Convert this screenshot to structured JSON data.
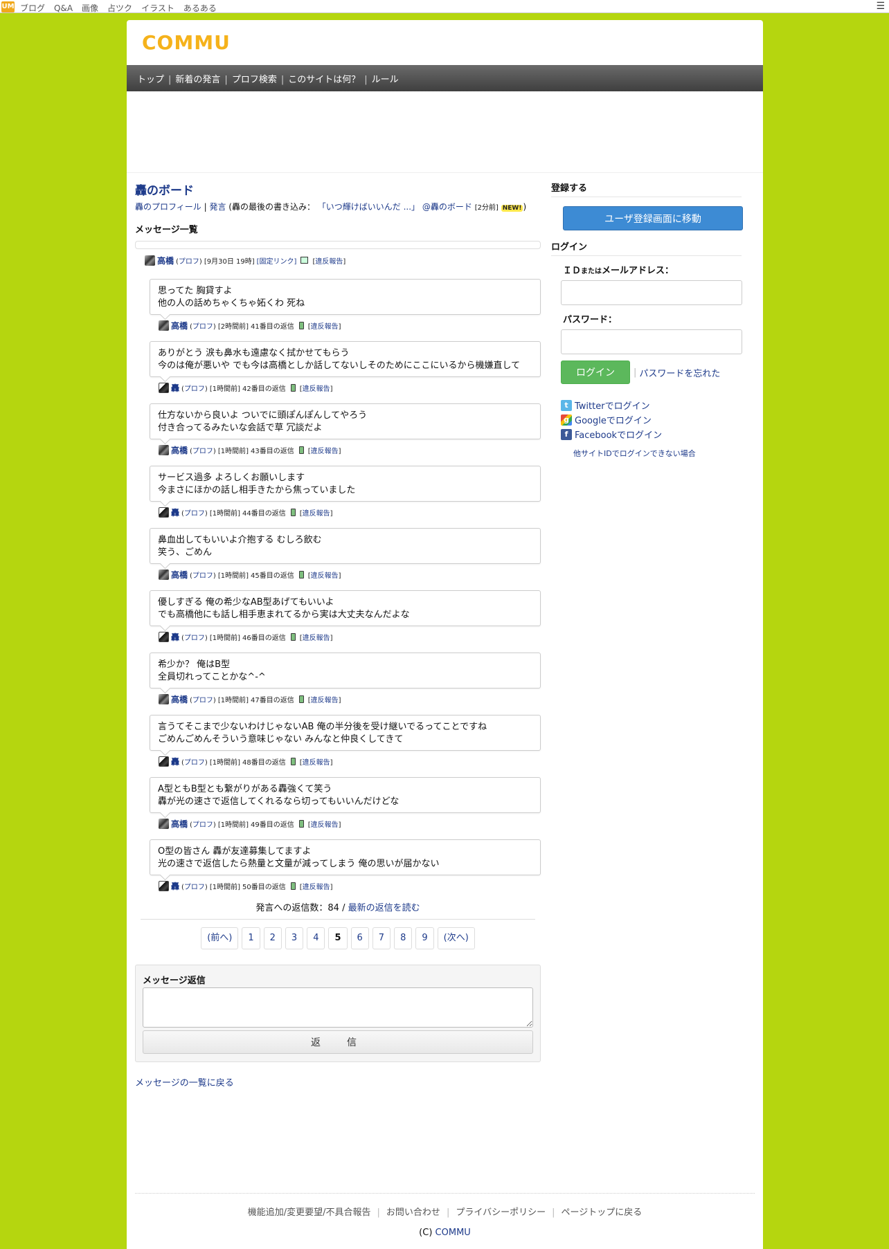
{
  "topbar": {
    "logo": "UM",
    "nav": [
      "ブログ",
      "Q&A",
      "画像",
      "占ツク",
      "イラスト",
      "あるある"
    ]
  },
  "site": {
    "logo": "COMMU"
  },
  "global_nav": [
    "トップ",
    "新着の発言",
    "プロフ検索",
    "このサイトは何？",
    "ルール"
  ],
  "board": {
    "title": "轟のボード",
    "profile_link": "轟のプロフィール",
    "statement_link": "発言",
    "last_post_prefix": "(轟の最後の書き込み：",
    "last_post_link": "「いつ輝けばいいんだ ...」",
    "last_post_board": "@轟のボード",
    "last_post_time": "[2分前]",
    "new_badge": "NEW!",
    "closing": ")"
  },
  "messages_heading": "メッセージ一覧",
  "root": {
    "name": "高橋",
    "prof": "プロフ",
    "time": "[9月30日 19時]",
    "permalink": "[固定リンク]",
    "report": "違反報告"
  },
  "replies": [
    {
      "lines": [
        "思ってた 胸貸すよ",
        "他の人の話めちゃくちゃ妬くわ 死ね"
      ],
      "name": "高橋",
      "avatar": "takahashi",
      "time": "[2時間前]",
      "num": "41番目の返信"
    },
    {
      "lines": [
        "ありがとう 涙も鼻水も遠慮なく拭かせてもらう",
        "今のは俺が悪いや でも今は高橋としか話してないしそのためにここにいるから機嫌直して"
      ],
      "name": "轟",
      "avatar": "todoroki",
      "time": "[1時間前]",
      "num": "42番目の返信"
    },
    {
      "lines": [
        "仕方ないから良いよ ついでに頭ぽんぽんしてやろう",
        "付き合ってるみたいな会話で草 冗談だよ"
      ],
      "name": "高橋",
      "avatar": "takahashi",
      "time": "[1時間前]",
      "num": "43番目の返信"
    },
    {
      "lines": [
        "サービス過多 よろしくお願いします",
        "今まさにほかの話し相手きたから焦っていました"
      ],
      "name": "轟",
      "avatar": "todoroki",
      "time": "[1時間前]",
      "num": "44番目の返信"
    },
    {
      "lines": [
        "鼻血出してもいいよ介抱する むしろ飲む",
        "笑う、ごめん"
      ],
      "name": "高橋",
      "avatar": "takahashi",
      "time": "[1時間前]",
      "num": "45番目の返信"
    },
    {
      "lines": [
        "優しすぎる 俺の希少なAB型あげてもいいよ",
        "でも高橋他にも話し相手恵まれてるから実は大丈夫なんだよな"
      ],
      "name": "轟",
      "avatar": "todoroki",
      "time": "[1時間前]",
      "num": "46番目の返信"
    },
    {
      "lines": [
        "希少か？ 俺はB型",
        "全員切れってことかな^-^"
      ],
      "name": "高橋",
      "avatar": "takahashi",
      "time": "[1時間前]",
      "num": "47番目の返信"
    },
    {
      "lines": [
        "言うてそこまで少ないわけじゃないAB 俺の半分後を受け継いでるってことですね",
        "ごめんごめんそういう意味じゃない みんなと仲良くしてきて"
      ],
      "name": "轟",
      "avatar": "todoroki",
      "time": "[1時間前]",
      "num": "48番目の返信"
    },
    {
      "lines": [
        "A型ともB型とも繋がりがある轟強くて笑う",
        "轟が光の速さで返信してくれるなら切ってもいいんだけどな"
      ],
      "name": "高橋",
      "avatar": "takahashi",
      "time": "[1時間前]",
      "num": "49番目の返信"
    },
    {
      "lines": [
        "O型の皆さん 轟が友達募集してますよ",
        "光の速さで返信したら熱量と文量が減ってしまう 俺の思いが届かない"
      ],
      "name": "轟",
      "avatar": "todoroki",
      "time": "[1時間前]",
      "num": "50番目の返信"
    }
  ],
  "reply_labels": {
    "prof": "プロフ",
    "report": "違反報告"
  },
  "count": {
    "text": "発言への返信数：84 /",
    "link": "最新の返信を読む"
  },
  "pager": {
    "prev": "(前へ)",
    "pages": [
      "1",
      "2",
      "3",
      "4",
      "5",
      "6",
      "7",
      "8",
      "9"
    ],
    "current": "5",
    "next": "(次へ)"
  },
  "reply_form": {
    "label": "メッセージ返信",
    "value": "",
    "submit": "返　信"
  },
  "back_link": "メッセージの一覧に戻る",
  "sidebar": {
    "register_heading": "登録する",
    "register_button": "ユーザ登録画面に移動",
    "login_heading": "ログイン",
    "id_label_a": "ＩＤ",
    "id_label_b": "または",
    "id_label_c": "メールアドレス：",
    "password_label": "パスワード：",
    "login_button": "ログイン",
    "forgot": "パスワードを忘れた",
    "twitter": "Twitterでログイン",
    "google": "Googleでログイン",
    "facebook": "Facebookでログイン",
    "other": "他サイトIDでログインできない場合"
  },
  "footer": {
    "links": [
      "機能追加/変更要望/不具合報告",
      "お問い合わせ",
      "プライバシーポリシー",
      "ページトップに戻る"
    ],
    "copy_prefix": "(C)",
    "copy_link": "COMMU"
  }
}
